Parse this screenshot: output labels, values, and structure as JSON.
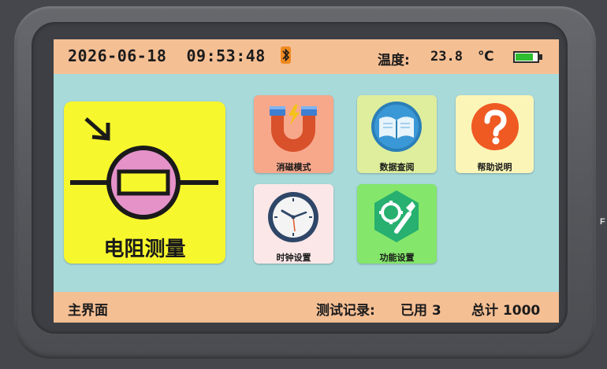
{
  "status_bar": {
    "datetime": "2026-06-18  09:53:48",
    "bluetooth_icon": "bluetooth-icon",
    "temperature_label": "温度:",
    "temperature_value": "23.8",
    "temperature_unit": "℃",
    "battery_level": 0.8
  },
  "main_tile": {
    "label": "电阻测量",
    "icon": "resistor-measurement-icon",
    "bg_color": "#f7f72e"
  },
  "tiles": [
    {
      "label": "消磁模式",
      "icon": "magnet-icon",
      "bg_color": "#f7a88b"
    },
    {
      "label": "数据查阅",
      "icon": "book-icon",
      "bg_color": "#dfee9c"
    },
    {
      "label": "帮助说明",
      "icon": "help-icon",
      "bg_color": "#fbf5b8"
    },
    {
      "label": "时钟设置",
      "icon": "clock-icon",
      "bg_color": "#fbe7e7"
    },
    {
      "label": "功能设置",
      "icon": "gear-wrench-icon",
      "bg_color": "#84e66b"
    }
  ],
  "footer": {
    "page_name": "主界面",
    "record_label": "测试记录:",
    "used_text": "已用 3",
    "total_text": "总计 1000"
  },
  "colors": {
    "screen_bg": "#a8dada",
    "bar_bg": "#f5bf94",
    "bezel": "#55575c"
  },
  "edge_mark": "F"
}
